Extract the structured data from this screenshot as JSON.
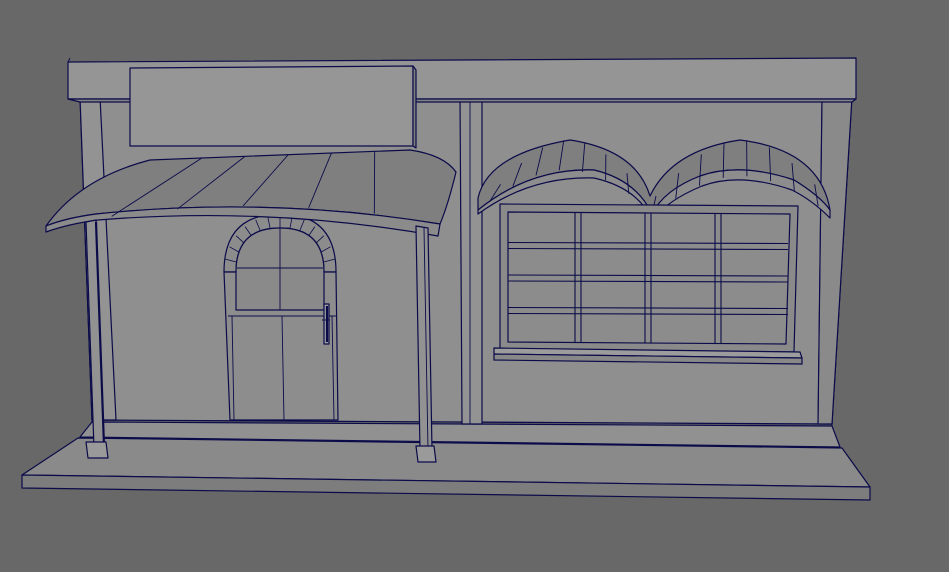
{
  "viewport": {
    "background": "#686868",
    "shading": {
      "wall": "#8f8f8f",
      "wall_light": "#9a9a9a",
      "wall_dark": "#858585",
      "ground": "#8a8a8a",
      "ground_edge": "#7a7a7a",
      "awning": "#7f7f7f",
      "awning_edge": "#888888",
      "wireframe": "#0b0b4a"
    }
  },
  "model": {
    "object_name": "shop-front",
    "parts": [
      "base-platform",
      "building-wall",
      "roof-trim",
      "sign-board",
      "door-awning",
      "awning-post-left",
      "awning-post-right",
      "arched-door",
      "door-handle",
      "window-awning",
      "shop-window",
      "window-sill"
    ],
    "window_grid": {
      "columns": 4,
      "rows": 4
    },
    "awning_planks": 5,
    "window_awning_ribs": 15
  }
}
